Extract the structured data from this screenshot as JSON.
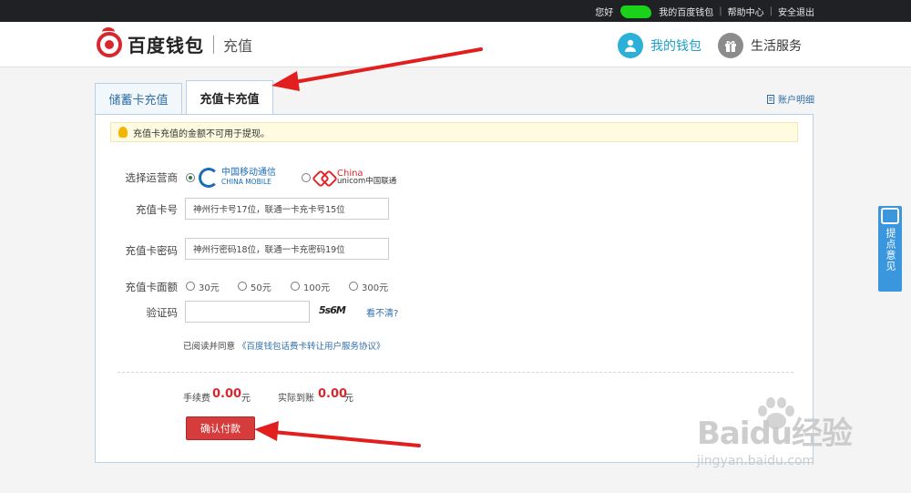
{
  "topbar": {
    "greeting": "您好",
    "my_wallet": "我的百度钱包",
    "help": "帮助中心",
    "logout": "安全退出",
    "separator": "|"
  },
  "header": {
    "logo_text": "百度钱包",
    "page_title": "充值",
    "my_wallet": "我的钱包",
    "life_service": "生活服务"
  },
  "tabs": [
    {
      "label": "储蓄卡充值"
    },
    {
      "label": "充值卡充值"
    }
  ],
  "account_detail": "账户明细",
  "notice": "充值卡充值的金额不可用于提现。",
  "form": {
    "operator_label": "选择运营商",
    "operators": [
      {
        "cn": "中国移动通信",
        "en": "CHINA MOBILE"
      },
      {
        "en1": "China",
        "en2": "unicom中国联通"
      }
    ],
    "card_no_label": "充值卡号",
    "card_no_placeholder": "神州行卡号17位，联通一卡充卡号15位",
    "password_label": "充值卡密码",
    "password_placeholder": "神州行密码18位，联通一卡充密码19位",
    "denomination_label": "充值卡面额",
    "denominations": [
      "30元",
      "50元",
      "100元",
      "300元"
    ],
    "captcha_label": "验证码",
    "captcha_image_text": "5s6M",
    "captcha_refresh": "看不清?",
    "agree_text": "已阅读并同意",
    "agree_link": "《百度钱包话费卡转让用户服务协议》"
  },
  "fees": {
    "fee_label": "手续费",
    "fee_value": "0.00",
    "fee_unit": "元",
    "actual_label": "实际到账",
    "actual_value": "0.00",
    "actual_unit": "元"
  },
  "pay_button": "确认付款",
  "feedback": "提点意见",
  "watermark": {
    "main": "Baidu经验",
    "sub": "jingyan.baidu.com"
  },
  "colors": {
    "accent_red": "#d7282f",
    "link_blue": "#2f6fa8",
    "arrow_red": "#e21f1f"
  }
}
